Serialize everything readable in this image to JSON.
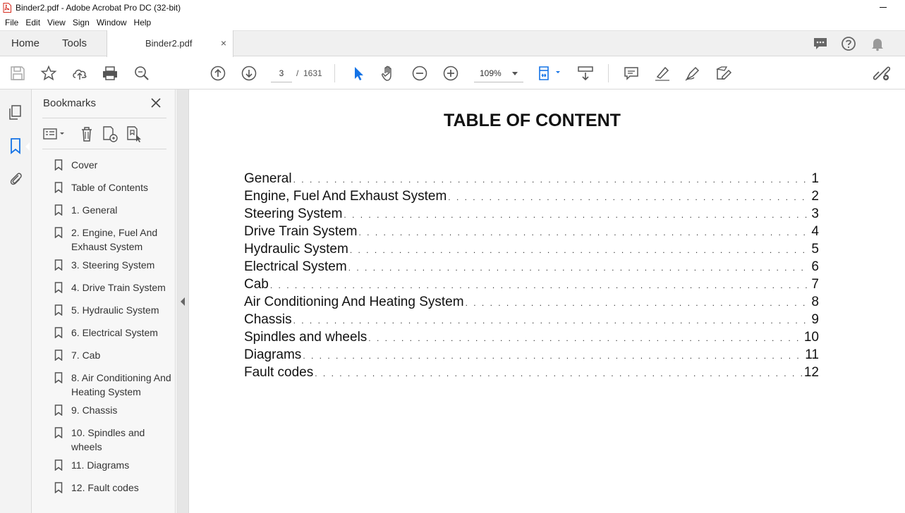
{
  "window": {
    "title": "Binder2.pdf - Adobe Acrobat Pro DC (32-bit)"
  },
  "menu": [
    "File",
    "Edit",
    "View",
    "Sign",
    "Window",
    "Help"
  ],
  "tabs": {
    "home": "Home",
    "tools": "Tools",
    "document": "Binder2.pdf"
  },
  "toolbar": {
    "current_page": "3",
    "page_separator": "/",
    "total_pages": "1631",
    "zoom": "109%"
  },
  "bookmarks_panel": {
    "title": "Bookmarks",
    "items": [
      {
        "label": "Cover"
      },
      {
        "label": "Table of Contents"
      },
      {
        "label": "1. General"
      },
      {
        "label": "2. Engine, Fuel And Exhaust System"
      },
      {
        "label": "3. Steering System"
      },
      {
        "label": "4. Drive Train System"
      },
      {
        "label": "5. Hydraulic System"
      },
      {
        "label": "6. Electrical System"
      },
      {
        "label": "7. Cab"
      },
      {
        "label": "8. Air Conditioning And Heating System"
      },
      {
        "label": "9. Chassis"
      },
      {
        "label": "10. Spindles and wheels"
      },
      {
        "label": "11. Diagrams"
      },
      {
        "label": "12. Fault codes"
      }
    ]
  },
  "document": {
    "heading": "TABLE OF CONTENT",
    "toc": [
      {
        "title": "General",
        "page": "1"
      },
      {
        "title": "Engine, Fuel And Exhaust System",
        "page": "2"
      },
      {
        "title": "Steering System",
        "page": "3"
      },
      {
        "title": "Drive Train System",
        "page": "4"
      },
      {
        "title": "Hydraulic System",
        "page": "5"
      },
      {
        "title": "Electrical System",
        "page": "6"
      },
      {
        "title": "Cab",
        "page": "7"
      },
      {
        "title": "Air Conditioning And Heating System",
        "page": "8"
      },
      {
        "title": "Chassis",
        "page": "9"
      },
      {
        "title": "Spindles and wheels",
        "page": "10"
      },
      {
        "title": "Diagrams",
        "page": "11"
      },
      {
        "title": "Fault codes",
        "page": "12"
      }
    ]
  },
  "colors": {
    "accent": "#1473e6",
    "pdf_red": "#d52b1e",
    "icon_gray": "#555555"
  }
}
